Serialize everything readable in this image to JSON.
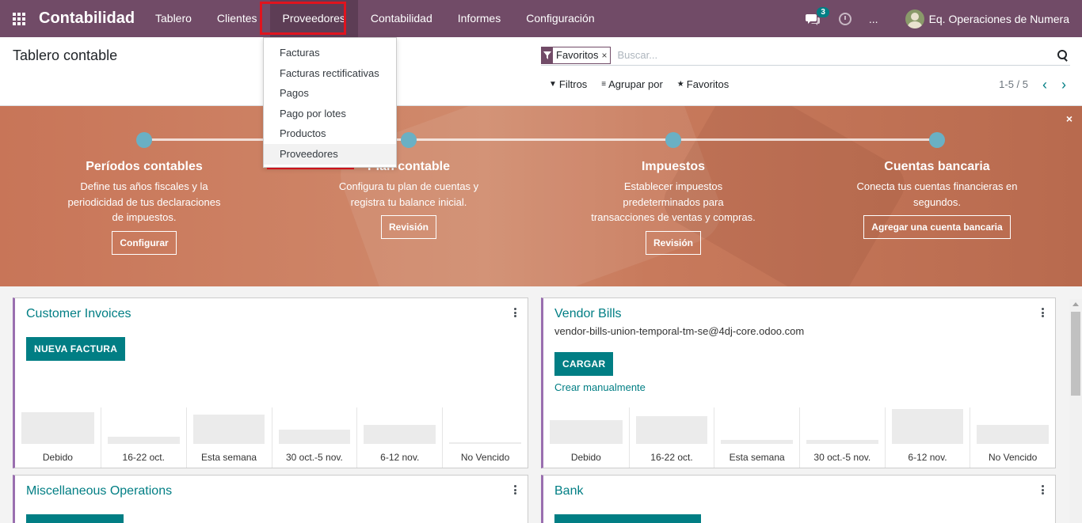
{
  "navbar": {
    "brand": "Contabilidad",
    "menu": [
      "Tablero",
      "Clientes",
      "Proveedores",
      "Contabilidad",
      "Informes",
      "Configuración"
    ],
    "active_menu": "Proveedores",
    "chat_badge": "3",
    "more": "...",
    "user": "Eq. Operaciones de Numera",
    "bg_color": "#714b67"
  },
  "dropdown": {
    "items": [
      "Facturas",
      "Facturas rectificativas",
      "Pagos",
      "Pago por lotes",
      "Productos",
      "Proveedores"
    ],
    "hovered": "Proveedores"
  },
  "control_panel": {
    "title": "Tablero contable",
    "facet": "Favoritos",
    "facet_close": "×",
    "search_placeholder": "Buscar...",
    "filters": "Filtros",
    "group_by": "Agrupar por",
    "favorites": "Favoritos",
    "pager": "1-5 / 5"
  },
  "banner": {
    "close": "×",
    "steps": [
      {
        "title": "Períodos contables",
        "desc": "Define tus años fiscales y la periodicidad de tus declaraciones de impuestos.",
        "button": "Configurar"
      },
      {
        "title": "Plan contable",
        "desc": "Configura tu plan de cuentas y registra tu balance inicial.",
        "button": "Revisión"
      },
      {
        "title": "Impuestos",
        "desc": "Establecer impuestos predeterminados para transacciones de ventas y compras.",
        "button": "Revisión"
      },
      {
        "title": "Cuentas bancaria",
        "desc": "Conecta tus cuentas financieras en segundos.",
        "button": "Agregar una cuenta bancaria"
      }
    ]
  },
  "cards": {
    "customer_invoices": {
      "title": "Customer Invoices",
      "button": "NUEVA FACTURA",
      "chart": {
        "labels": [
          "Debido",
          "16-22 oct.",
          "Esta semana",
          "30 oct.-5 nov.",
          "6-12 nov.",
          "No Vencido"
        ],
        "values": [
          0.9,
          0.2,
          0.85,
          0.4,
          0.55,
          0.04
        ]
      }
    },
    "vendor_bills": {
      "title": "Vendor Bills",
      "email": "vendor-bills-union-temporal-tm-se@4dj-core.odoo.com",
      "button": "CARGAR",
      "link": "Crear manualmente",
      "chart": {
        "labels": [
          "Debido",
          "16-22 oct.",
          "Esta semana",
          "30 oct.-5 nov.",
          "6-12 nov.",
          "No Vencido"
        ],
        "values": [
          0.68,
          0.8,
          0.12,
          0.12,
          1.0,
          0.55
        ]
      }
    },
    "misc": {
      "title": "Miscellaneous Operations"
    },
    "bank": {
      "title": "Bank"
    }
  }
}
